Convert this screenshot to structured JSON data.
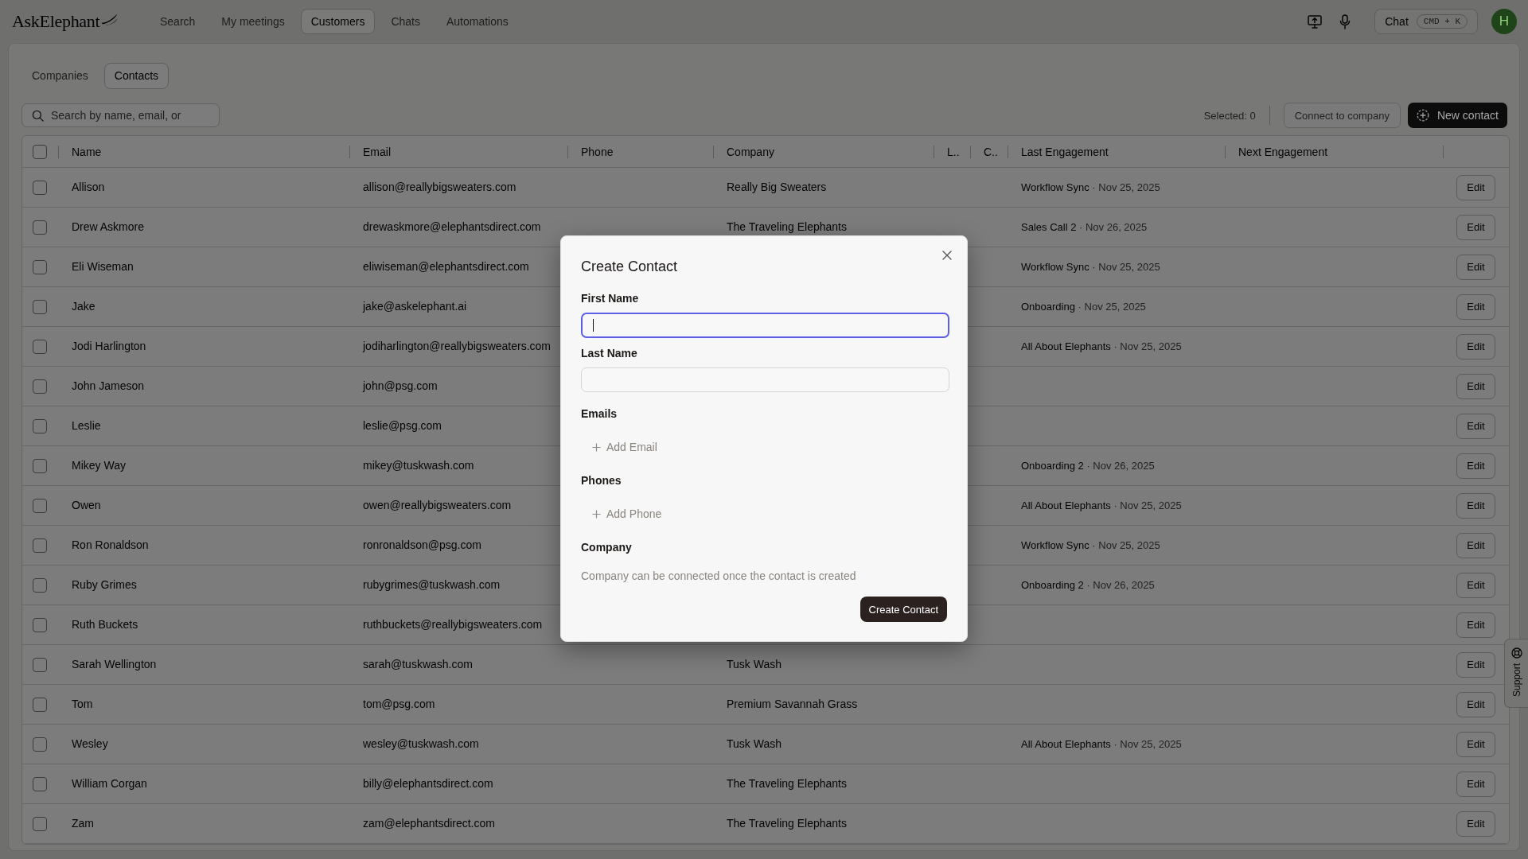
{
  "app": {
    "logo": "AskElephant"
  },
  "nav": [
    {
      "label": "Search",
      "selected": false
    },
    {
      "label": "My meetings",
      "selected": false
    },
    {
      "label": "Customers",
      "selected": true
    },
    {
      "label": "Chats",
      "selected": false
    },
    {
      "label": "Automations",
      "selected": false
    }
  ],
  "header_actions": {
    "chat": {
      "label": "Chat",
      "shortcut": "CMD + K"
    },
    "avatar": "H"
  },
  "tabs": [
    {
      "label": "Companies",
      "selected": false
    },
    {
      "label": "Contacts",
      "selected": true
    }
  ],
  "search": {
    "placeholder": "Search by name, email, or"
  },
  "toolbar": {
    "selected_count": "Selected: 0",
    "connect": {
      "label": "Connect to company",
      "disabled": true
    },
    "new_button": "New contact"
  },
  "table": {
    "header_checked": false,
    "columns": [
      "Name",
      "Email",
      "Phone",
      "Company",
      "L..",
      "C..",
      "Last Engagement",
      "Next Engagement"
    ],
    "rows": [
      {
        "checked": false,
        "name": "Allison",
        "email": "allison@reallybigsweaters.com",
        "company": "Really Big Sweaters",
        "last_engagement": {
          "title": "Workflow Sync",
          "date": "· Nov 25, 2025"
        },
        "action": "Edit"
      },
      {
        "checked": false,
        "name": "Drew Askmore",
        "email": "drewaskmore@elephantsdirect.com",
        "company": "The Traveling Elephants",
        "last_engagement": {
          "title": "Sales Call 2",
          "date": "· Nov 26, 2025"
        },
        "action": "Edit"
      },
      {
        "checked": false,
        "name": "Eli Wiseman",
        "email": "eliwiseman@elephantsdirect.com",
        "last_engagement": {
          "title": "Workflow Sync",
          "date": "· Nov 25, 2025"
        },
        "action": "Edit"
      },
      {
        "checked": false,
        "name": "Jake",
        "email": "jake@askelephant.ai",
        "last_engagement": {
          "title": "Onboarding",
          "date": "· Nov 25, 2025"
        },
        "action": "Edit"
      },
      {
        "checked": false,
        "name": "Jodi Harlington",
        "email": "jodiharlington@reallybigsweaters.com",
        "last_engagement": {
          "title": "All About Elephants",
          "date": "· Nov 25, 2025"
        },
        "action": "Edit"
      },
      {
        "checked": false,
        "name": "John Jameson",
        "email": "john@psg.com",
        "action": "Edit"
      },
      {
        "checked": false,
        "name": "Leslie",
        "email": "leslie@psg.com",
        "action": "Edit"
      },
      {
        "checked": false,
        "name": "Mikey Way",
        "email": "mikey@tuskwash.com",
        "last_engagement": {
          "title": "Onboarding 2",
          "date": "· Nov 26, 2025"
        },
        "action": "Edit"
      },
      {
        "checked": false,
        "name": "Owen",
        "email": "owen@reallybigsweaters.com",
        "last_engagement": {
          "title": "All About Elephants",
          "date": "· Nov 25, 2025"
        },
        "action": "Edit"
      },
      {
        "checked": false,
        "name": "Ron Ronaldson",
        "email": "ronronaldson@psg.com",
        "last_engagement": {
          "title": "Workflow Sync",
          "date": "· Nov 25, 2025"
        },
        "action": "Edit"
      },
      {
        "checked": false,
        "name": "Ruby Grimes",
        "email": "rubygrimes@tuskwash.com",
        "last_engagement": {
          "title": "Onboarding 2",
          "date": "· Nov 26, 2025"
        },
        "action": "Edit"
      },
      {
        "checked": false,
        "name": "Ruth Buckets",
        "email": "ruthbuckets@reallybigsweaters.com",
        "action": "Edit"
      },
      {
        "checked": false,
        "name": "Sarah Wellington",
        "email": "sarah@tuskwash.com",
        "company": "Tusk Wash",
        "action": "Edit"
      },
      {
        "checked": false,
        "name": "Tom",
        "email": "tom@psg.com",
        "company": "Premium Savannah Grass",
        "action": "Edit"
      },
      {
        "checked": false,
        "name": "Wesley",
        "email": "wesley@tuskwash.com",
        "company": "Tusk Wash",
        "last_engagement": {
          "title": "All About Elephants",
          "date": "· Nov 25, 2025"
        },
        "action": "Edit"
      },
      {
        "checked": false,
        "name": "William Corgan",
        "email": "billy@elephantsdirect.com",
        "company": "The Traveling Elephants",
        "action": "Edit"
      },
      {
        "checked": false,
        "name": "Zam",
        "email": "zam@elephantsdirect.com",
        "company": "The Traveling Elephants",
        "action": "Edit"
      }
    ]
  },
  "modal": {
    "title": "Create Contact",
    "fields": [
      {
        "label": "First Name",
        "focused": true
      },
      {
        "label": "Last Name",
        "focused": false
      }
    ],
    "sections": [
      {
        "label": "Emails",
        "action": "Add Email"
      },
      {
        "label": "Phones",
        "action": "Add Phone"
      }
    ],
    "company": {
      "label": "Company",
      "hint": "Company can be connected once the contact is created"
    },
    "submit": "Create Contact"
  },
  "support": {
    "label": "Support"
  }
}
